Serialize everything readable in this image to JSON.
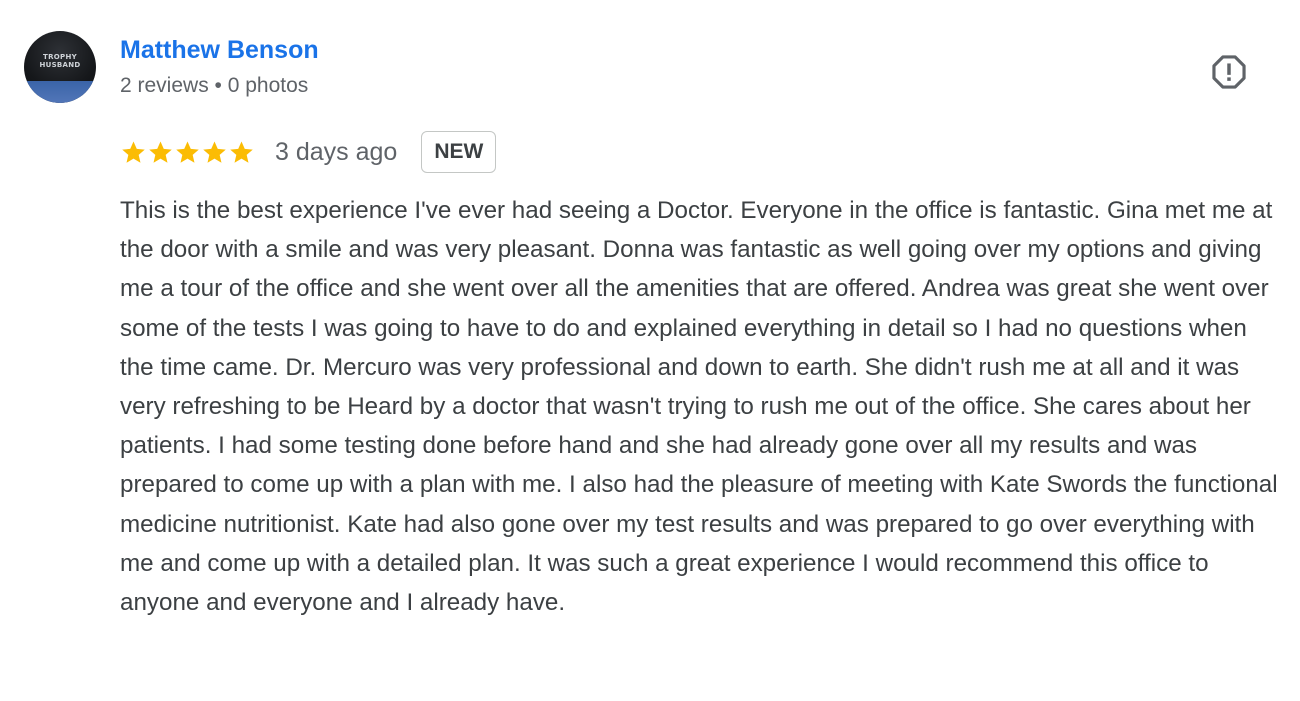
{
  "author": {
    "name": "Matthew Benson",
    "meta": "2 reviews • 0 photos",
    "avatar_caption": "TROPHY HUSBAND"
  },
  "review": {
    "rating": 5,
    "rating_max": 5,
    "time": "3 days ago",
    "badge": "NEW",
    "text": "This is the best experience I've ever had seeing a Doctor. Everyone in the office is fantastic. Gina met me at the door with a smile and was very pleasant. Donna was fantastic as well going over my options and giving me a tour of the office and she went over all the amenities that are offered. Andrea was great she went over some of the tests I was going to have to do and explained everything in detail so I had no questions when the time came. Dr. Mercuro was very professional and down to earth. She didn't rush me at all and it was very refreshing to be Heard by a doctor that wasn't trying to rush me out of the office. She cares about her patients. I had some testing done before hand and she had already gone over all my results and was prepared to come up with a plan with me. I also had the pleasure of meeting with Kate Swords the functional medicine nutritionist. Kate had also gone over my test results and was prepared to go over everything with me and come up with a detailed plan. It was such a great experience I would recommend this office to anyone and everyone and I already have."
  },
  "icons": {
    "report": "report-flag-icon",
    "star": "star-icon"
  },
  "colors": {
    "name_link": "#1a73e8",
    "star": "#fbbc04",
    "meta_text": "#5f6368",
    "body_text": "#3c4043",
    "badge_border": "#c4c7c5"
  }
}
